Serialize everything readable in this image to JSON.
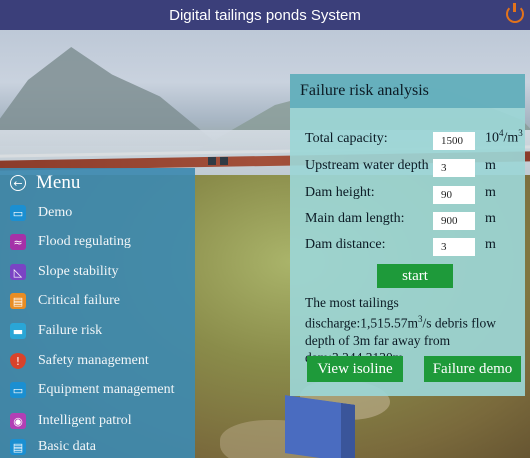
{
  "app": {
    "title": "Digital tailings ponds System",
    "power_icon": "power-icon",
    "title_bar_color": "#3b3f7a",
    "accent_color": "#1e9a3a"
  },
  "menu": {
    "title": "Menu",
    "back_icon": "arrow-left-circle-icon",
    "items": [
      {
        "label": "Demo",
        "icon": "monitor-icon",
        "icon_color": "#1b8fd1",
        "glyph": "▭"
      },
      {
        "label": "Flood regulating",
        "icon": "waves-icon",
        "icon_color": "#a531a8",
        "glyph": "≈"
      },
      {
        "label": "Slope stability",
        "icon": "slope-icon",
        "icon_color": "#7a44c4",
        "glyph": "◺"
      },
      {
        "label": "Critical failure",
        "icon": "chart-icon",
        "icon_color": "#e88d25",
        "glyph": "▤"
      },
      {
        "label": "Failure risk",
        "icon": "folder-icon",
        "icon_color": "#2aa6d6",
        "glyph": "▬"
      },
      {
        "label": "Safety management",
        "icon": "alert-shield-icon",
        "icon_color": "#d8432b",
        "glyph": "!"
      },
      {
        "label": "Equipment management",
        "icon": "desktop-icon",
        "icon_color": "#1b8fd1",
        "glyph": "▭"
      },
      {
        "label": "Intelligent patrol",
        "icon": "patrol-icon",
        "icon_color": "#b23fb5",
        "glyph": "◉"
      },
      {
        "label": "Basic data",
        "icon": "document-icon",
        "icon_color": "#1b8fd1",
        "glyph": "▤"
      }
    ]
  },
  "panel": {
    "title": "Failure risk analysis",
    "fields": [
      {
        "label": "Total capacity:",
        "value": "1500",
        "unit_base": "10",
        "unit_sup": "4",
        "unit_tail": "/m",
        "unit_sup2": "3"
      },
      {
        "label": "Upstream water depth :",
        "value": "3",
        "unit": "m"
      },
      {
        "label": "Dam height:",
        "value": "90",
        "unit": "m"
      },
      {
        "label": "Main dam length:",
        "value": "900",
        "unit": "m"
      },
      {
        "label": "Dam distance:",
        "value": "3",
        "unit": "m"
      }
    ],
    "start_label": "start",
    "result_prefix": "The most tailings discharge:1,515.57m",
    "result_sup": "3",
    "result_suffix": "/s",
    "result_rest": "debris flow depth of 3m far away from dam:3,244.3130m",
    "view_isoline_label": "View isoline",
    "failure_demo_label": "Failure demo"
  }
}
